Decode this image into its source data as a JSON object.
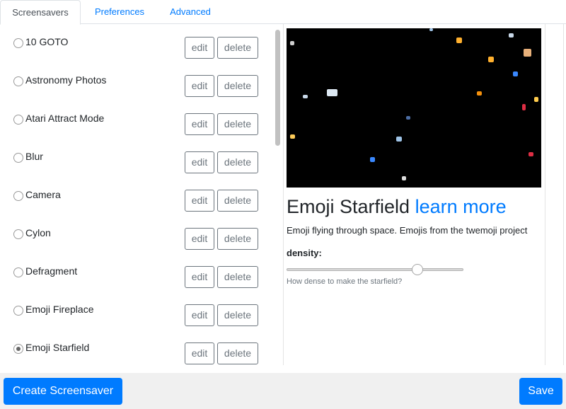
{
  "tabs": [
    {
      "label": "Screensavers",
      "active": true
    },
    {
      "label": "Preferences",
      "active": false
    },
    {
      "label": "Advanced",
      "active": false
    }
  ],
  "screensavers": [
    {
      "name": "10 GOTO",
      "selected": false
    },
    {
      "name": "Astronomy Photos",
      "selected": false
    },
    {
      "name": "Atari Attract Mode",
      "selected": false
    },
    {
      "name": "Blur",
      "selected": false
    },
    {
      "name": "Camera",
      "selected": false
    },
    {
      "name": "Cylon",
      "selected": false
    },
    {
      "name": "Defragment",
      "selected": false
    },
    {
      "name": "Emoji Fireplace",
      "selected": false
    },
    {
      "name": "Emoji Starfield",
      "selected": true
    }
  ],
  "row_actions": {
    "edit_label": "edit",
    "delete_label": "delete"
  },
  "detail": {
    "title": "Emoji Starfield",
    "learn_more": "learn more",
    "description": "Emoji flying through space. Emojis from the twemoji project",
    "option_label": "density:",
    "option_help": "How dense to make the starfield?",
    "density_fraction": 0.74,
    "preview_icons": [
      "emoji-icon",
      "emoji-icon",
      "emoji-icon",
      "emoji-icon",
      "emoji-icon",
      "emoji-icon",
      "emoji-icon",
      "emoji-icon",
      "emoji-icon",
      "emoji-icon",
      "emoji-icon",
      "emoji-icon",
      "emoji-icon",
      "emoji-icon",
      "emoji-icon",
      "emoji-icon",
      "emoji-icon",
      "emoji-icon"
    ]
  },
  "footer": {
    "create_label": "Create Screensaver",
    "save_label": "Save"
  },
  "colors": {
    "accent": "#007bff",
    "preview_bg": "#000000",
    "footer_bg": "#f0f0f0"
  }
}
